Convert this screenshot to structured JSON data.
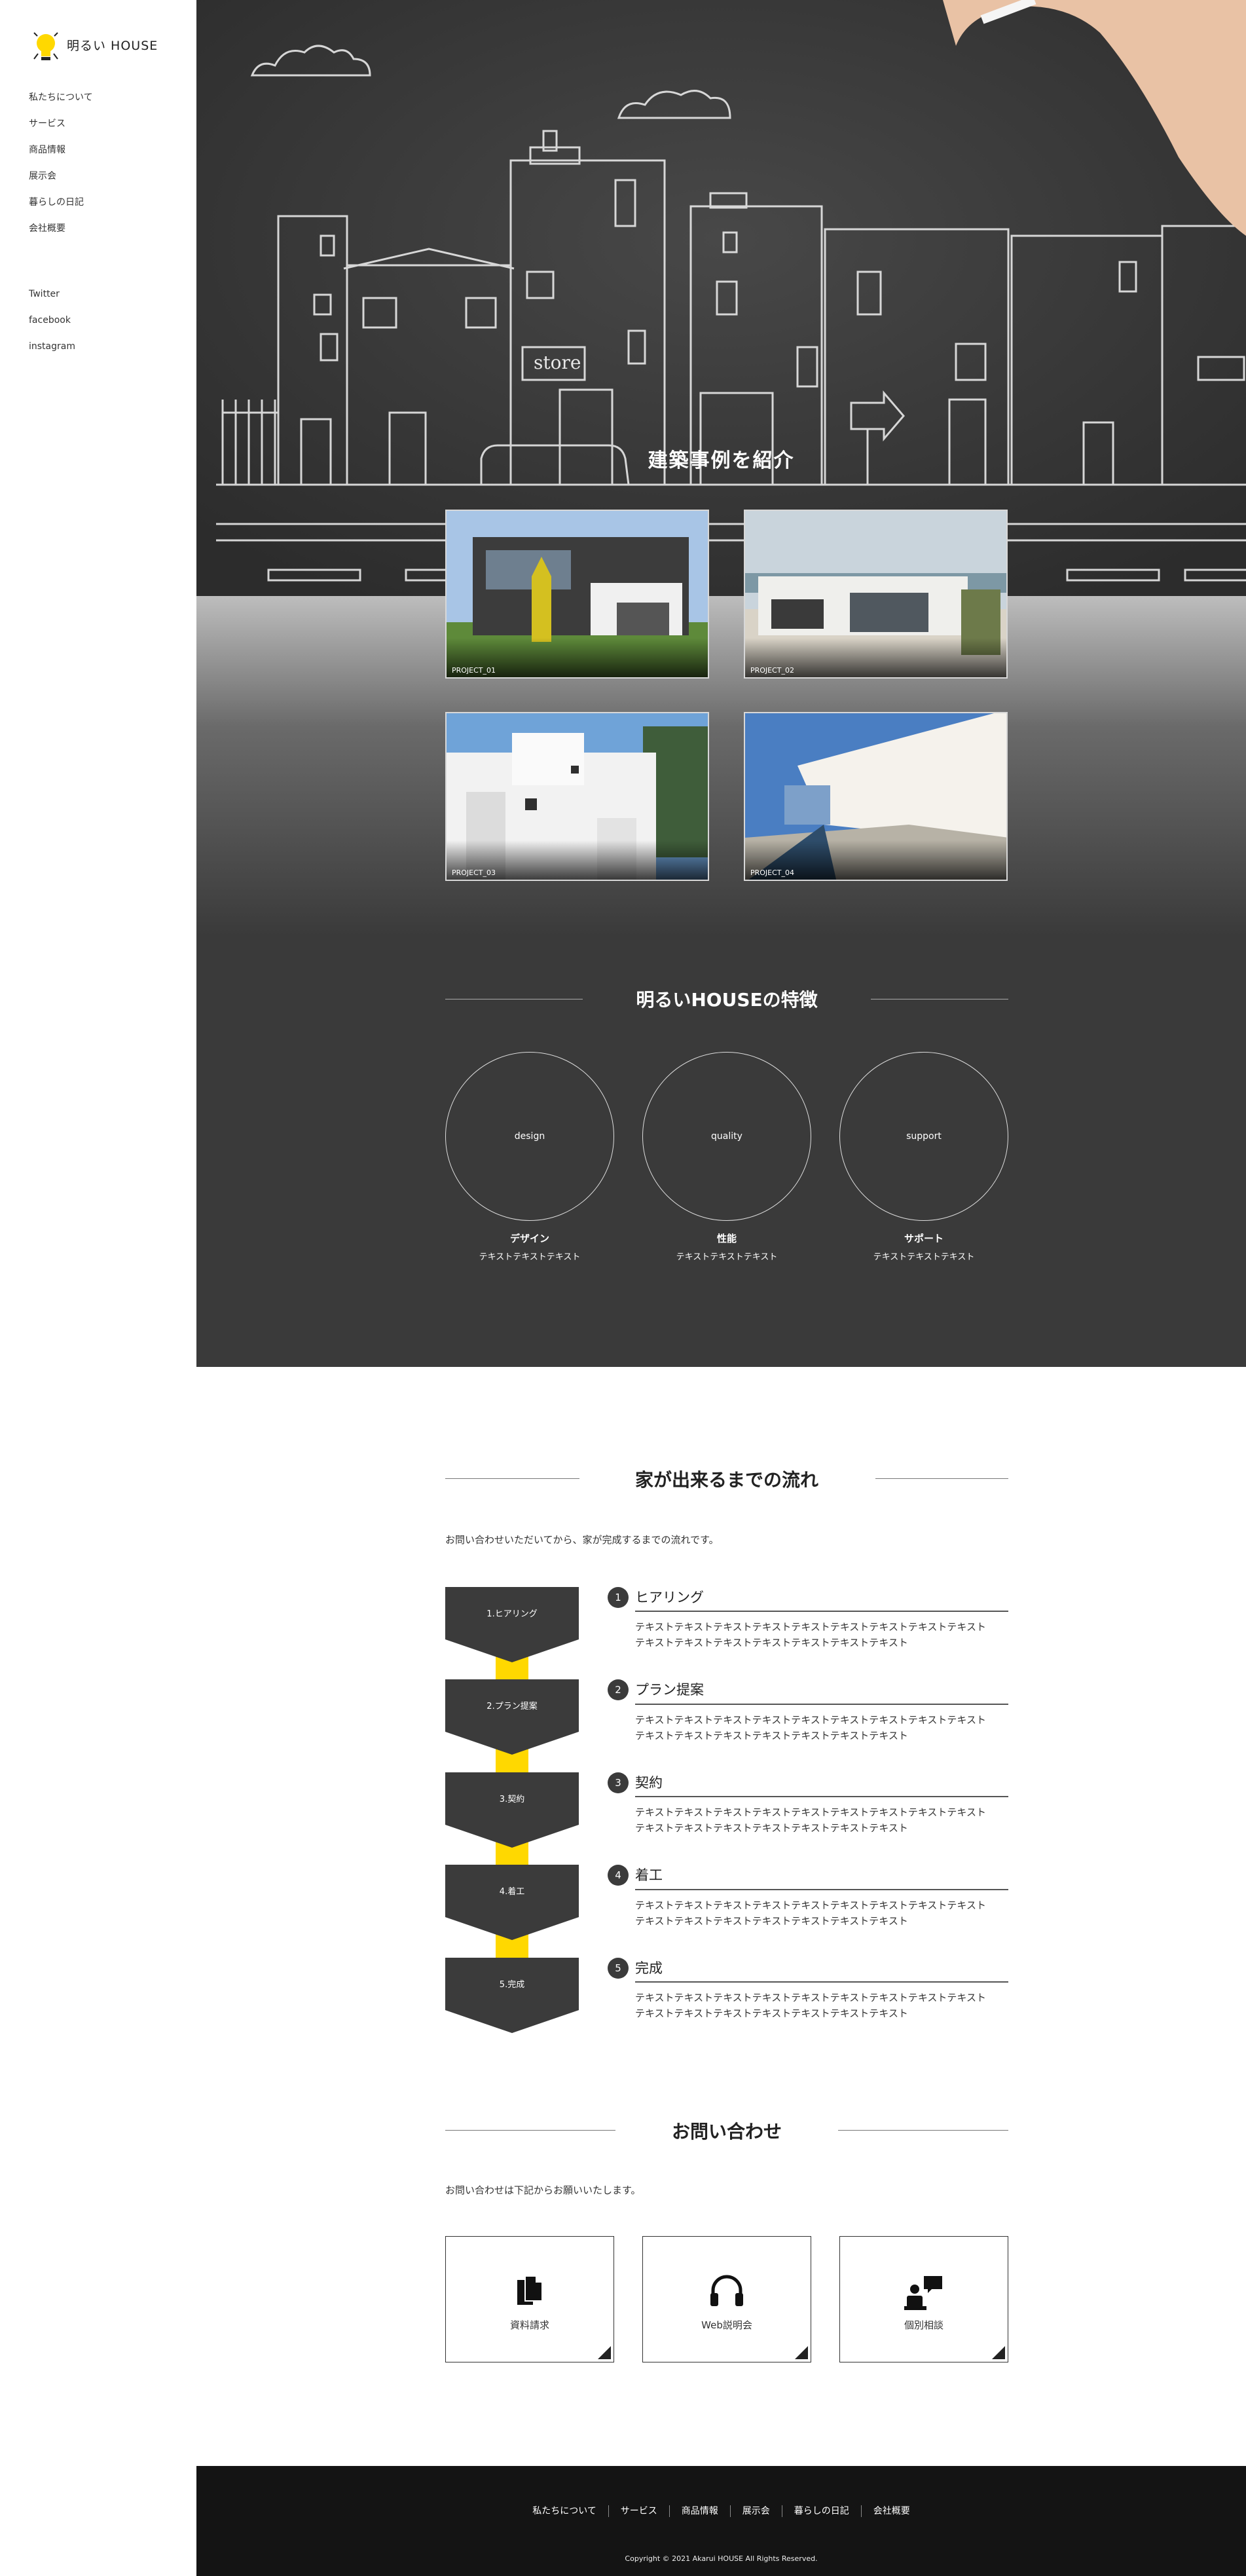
{
  "brand": {
    "name": "明るい HOUSE",
    "accent": "#ffd800",
    "dark": "#3a3a3a"
  },
  "nav": [
    "私たちについて",
    "サービス",
    "商品情報",
    "展示会",
    "暮らしの日記",
    "会社概要"
  ],
  "social": [
    "Twitter",
    "facebook",
    "instagram"
  ],
  "hero": {
    "sign_text": "store"
  },
  "works": {
    "title": "建築事例を紹介",
    "projects": [
      "PROJECT_01",
      "PROJECT_02",
      "PROJECT_03",
      "PROJECT_04"
    ]
  },
  "features": {
    "title": "明るいHOUSEの特徴",
    "items": [
      {
        "circle": "design",
        "name": "デザイン",
        "desc": "テキストテキストテキスト"
      },
      {
        "circle": "quality",
        "name": "性能",
        "desc": "テキストテキストテキスト"
      },
      {
        "circle": "support",
        "name": "サポート",
        "desc": "テキストテキストテキスト"
      }
    ]
  },
  "flow": {
    "title": "家が出来るまでの流れ",
    "intro": "お問い合わせいただいてから、家が完成するまでの流れです。",
    "steps": [
      {
        "box": "1.ヒアリング",
        "num": "1",
        "title": "ヒアリング",
        "line1": "テキストテキストテキストテキストテキストテキストテキストテキストテキスト",
        "line2": "テキストテキストテキストテキストテキストテキストテキスト"
      },
      {
        "box": "2.プラン提案",
        "num": "2",
        "title": "プラン提案",
        "line1": "テキストテキストテキストテキストテキストテキストテキストテキストテキスト",
        "line2": "テキストテキストテキストテキストテキストテキストテキスト"
      },
      {
        "box": "3.契約",
        "num": "3",
        "title": "契約",
        "line1": "テキストテキストテキストテキストテキストテキストテキストテキストテキスト",
        "line2": "テキストテキストテキストテキストテキストテキストテキスト"
      },
      {
        "box": "4.着工",
        "num": "4",
        "title": "着工",
        "line1": "テキストテキストテキストテキストテキストテキストテキストテキストテキスト",
        "line2": "テキストテキストテキストテキストテキストテキストテキスト"
      },
      {
        "box": "5.完成",
        "num": "5",
        "title": "完成",
        "line1": "テキストテキストテキストテキストテキストテキストテキストテキストテキスト",
        "line2": "テキストテキストテキストテキストテキストテキストテキスト"
      }
    ]
  },
  "contact": {
    "title": "お問い合わせ",
    "intro": "お問い合わせは下記からお願いいたします。",
    "cards": [
      {
        "label": "資料請求",
        "icon": "document-icon"
      },
      {
        "label": "Web説明会",
        "icon": "headset-icon"
      },
      {
        "label": "個別相談",
        "icon": "consultation-icon"
      }
    ]
  },
  "footer": {
    "nav": [
      "私たちについて",
      "サービス",
      "商品情報",
      "展示会",
      "暮らしの日記",
      "会社概要"
    ],
    "copyright": "Copyright © 2021 Akarui HOUSE All Rights Reserved."
  }
}
